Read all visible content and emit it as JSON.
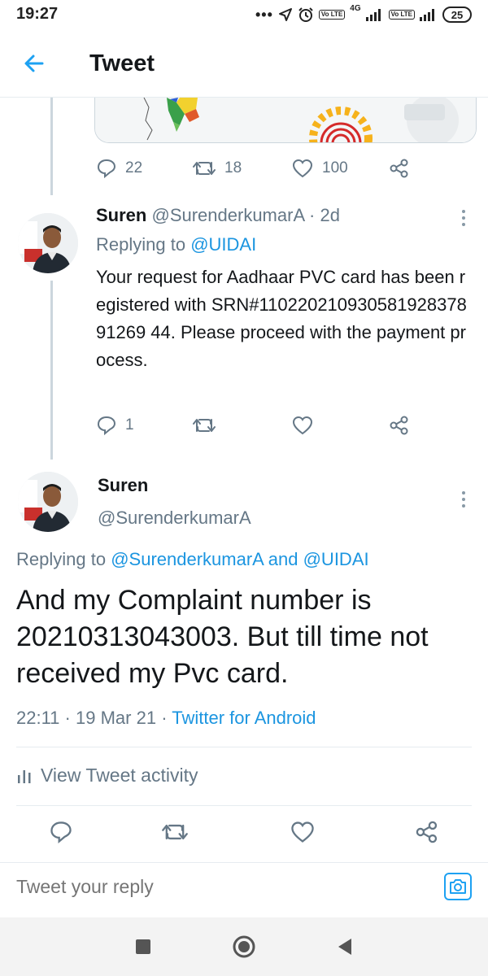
{
  "status_bar": {
    "time": "19:27",
    "battery": "25",
    "network_label": "4G",
    "volte_label": "Vo LTE"
  },
  "header": {
    "title": "Tweet",
    "back_icon": "arrow-left-icon"
  },
  "top_tweet": {
    "actions": {
      "replies": "22",
      "retweets": "18",
      "likes": "100"
    }
  },
  "reply_tweet": {
    "name": "Suren",
    "handle": "@SurenderkumarA",
    "separator": "·",
    "time": "2d",
    "replying_prefix": "Replying to",
    "replying_to": "@UIDAI",
    "text": "Your request for Aadhaar PVC card has been registered with SRN#11022021093058192837891269 44. Please proceed with the payment process.",
    "actions": {
      "replies": "1",
      "retweets": "",
      "likes": ""
    }
  },
  "main_tweet": {
    "name": "Suren",
    "handle": "@SurenderkumarA",
    "replying_prefix": "Replying to",
    "replying_to_1": "@SurenderkumarA",
    "replying_and": "and",
    "replying_to_2": "@UIDAI",
    "text": "And my Complaint number is 20210313043003. But till time not received my Pvc card.",
    "time": "22:11",
    "date": "19 Mar 21",
    "separator": "·",
    "source": "Twitter for Android",
    "activity_label": "View Tweet activity"
  },
  "compose": {
    "placeholder": "Tweet your reply"
  },
  "colors": {
    "accent": "#1da1f2",
    "link": "#1b95e0",
    "muted": "#657786",
    "divider": "#e6ecf0"
  }
}
